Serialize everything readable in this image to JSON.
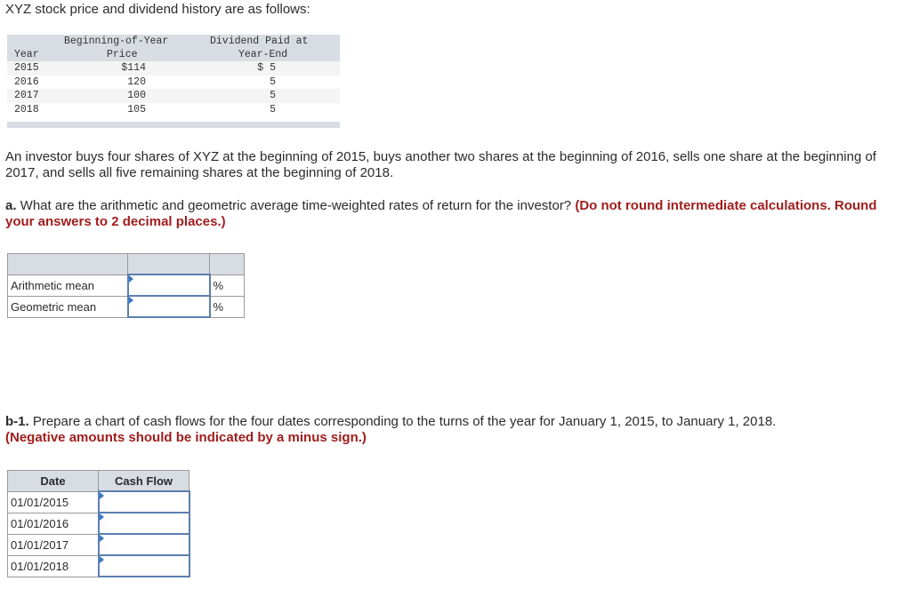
{
  "intro": "XYZ stock price and dividend history are as follows:",
  "stock_table": {
    "headers": {
      "year": "Year",
      "price_line1": "Beginning-of-Year",
      "price_line2": "Price",
      "div_line1": "Dividend Paid at",
      "div_line2": "Year-End"
    },
    "rows": [
      {
        "year": "2015",
        "price": "$114",
        "dividend": "$ 5"
      },
      {
        "year": "2016",
        "price": "120",
        "dividend": "5"
      },
      {
        "year": "2017",
        "price": "100",
        "dividend": "5"
      },
      {
        "year": "2018",
        "price": "105",
        "dividend": "5"
      }
    ]
  },
  "scenario": "An investor buys four shares of XYZ at the beginning of 2015, buys another two shares at the beginning of 2016, sells one share at the beginning of 2017, and sells all five remaining shares at the beginning of 2018.",
  "part_a": {
    "label": "a.",
    "question": " What are the arithmetic and geometric average time-weighted rates of return for the investor? ",
    "instruction": "(Do not round intermediate calculations. Round your answers to 2 decimal places.)",
    "rows": [
      {
        "label": "Arithmetic mean",
        "value": "",
        "unit": "%"
      },
      {
        "label": "Geometric mean",
        "value": "",
        "unit": "%"
      }
    ]
  },
  "part_b1": {
    "label": "b-1.",
    "question": " Prepare a chart of cash flows for the four dates corresponding to the turns of the year for January 1, 2015, to January 1, 2018.",
    "instruction": "(Negative amounts should be indicated by a minus sign.)",
    "headers": {
      "date": "Date",
      "cash_flow": "Cash Flow"
    },
    "rows": [
      {
        "date": "01/01/2015",
        "value": ""
      },
      {
        "date": "01/01/2016",
        "value": ""
      },
      {
        "date": "01/01/2017",
        "value": ""
      },
      {
        "date": "01/01/2018",
        "value": ""
      }
    ]
  }
}
